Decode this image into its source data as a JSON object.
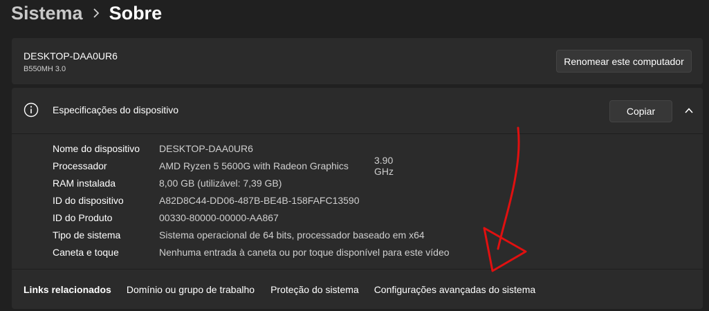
{
  "breadcrumb": {
    "parent": "Sistema",
    "current": "Sobre"
  },
  "device": {
    "name": "DESKTOP-DAA0UR6",
    "model": "B550MH 3.0",
    "rename_label": "Renomear este computador"
  },
  "specs": {
    "title": "Especificações do dispositivo",
    "copy_label": "Copiar",
    "rows": [
      {
        "label": "Nome do dispositivo",
        "value": "DESKTOP-DAA0UR6"
      },
      {
        "label": "Processador",
        "value": "AMD Ryzen 5 5600G with Radeon Graphics",
        "extra": "3.90 GHz"
      },
      {
        "label": "RAM instalada",
        "value": "8,00 GB (utilizável: 7,39 GB)"
      },
      {
        "label": "ID do dispositivo",
        "value": "A82D8C44-DD06-487B-BE4B-158FAFC13590"
      },
      {
        "label": "ID do Produto",
        "value": "00330-80000-00000-AA867"
      },
      {
        "label": "Tipo de sistema",
        "value": "Sistema operacional de 64 bits, processador baseado em x64"
      },
      {
        "label": "Caneta e toque",
        "value": "Nenhuma entrada à caneta ou por toque disponível para este vídeo"
      }
    ]
  },
  "related_links": {
    "title": "Links relacionados",
    "items": [
      "Domínio ou grupo de trabalho",
      "Proteção do sistema",
      "Configurações avançadas do sistema"
    ]
  },
  "colors": {
    "background": "#202020",
    "card": "#2b2b2b",
    "button": "#373737",
    "annotation": "#e01010"
  },
  "icons": [
    "chevron-right-icon",
    "info-icon",
    "chevron-up-icon"
  ]
}
